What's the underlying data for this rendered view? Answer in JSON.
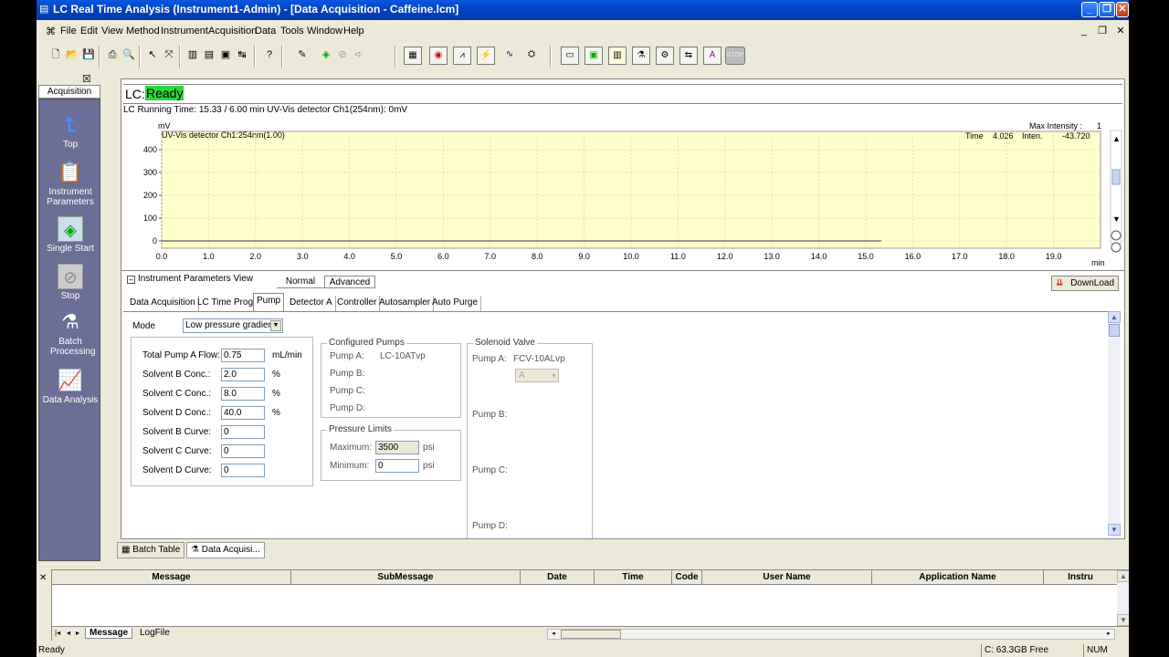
{
  "window": {
    "title": "LC Real Time Analysis (Instrument1-Admin) - [Data Acquisition - Caffeine.lcm]"
  },
  "menu": [
    "File",
    "Edit",
    "View",
    "Method",
    "Instrument",
    "Acquisition",
    "Data",
    "Tools",
    "Window",
    "Help"
  ],
  "sidebar": {
    "tab": "Acquisition",
    "items": [
      {
        "label": "Top",
        "icon": "up-arrow-icon"
      },
      {
        "label": "Instrument Parameters",
        "icon": "instrument-parameters-icon"
      },
      {
        "label": "Single Start",
        "icon": "single-start-icon"
      },
      {
        "label": "Stop",
        "icon": "stop-icon"
      },
      {
        "label": "Batch Processing",
        "icon": "batch-processing-icon"
      },
      {
        "label": "Data Analysis",
        "icon": "data-analysis-icon"
      }
    ]
  },
  "lc_status": {
    "label": "LC:",
    "value": "Ready",
    "color": "#2cd83b"
  },
  "running_text": "LC Running Time: 15.33 / 6.00 min UV-Vis detector Ch1(254nm): 0mV",
  "chart_data": {
    "type": "line",
    "ylabel": "mV",
    "xlabel": "min",
    "series_label": "UV-Vis detector Ch1:254nm(1.00)",
    "y_ticks": [
      400,
      300,
      200,
      100,
      0
    ],
    "x_ticks": [
      "0.0",
      "1.0",
      "2.0",
      "3.0",
      "4.0",
      "5.0",
      "6.0",
      "7.0",
      "8.0",
      "9.0",
      "10.0",
      "11.0",
      "12.0",
      "13.0",
      "14.0",
      "15.0",
      "16.0",
      "17.0",
      "18.0",
      "19.0"
    ],
    "ylim": [
      0,
      480
    ],
    "xlim": [
      0,
      20
    ],
    "series": [
      {
        "x": [
          0,
          15.33
        ],
        "y": [
          0,
          0
        ]
      }
    ],
    "readout": {
      "max_intensity_label": "Max Intensity :",
      "max_intensity_value": "1",
      "time_label": "Time",
      "time_value": "4.026",
      "inten_label": "Inten.",
      "inten_value": "-43.720"
    },
    "background": "#ffffcc"
  },
  "params_view": {
    "title": "Instrument Parameters View",
    "view_tabs": [
      "Normal",
      "Advanced"
    ],
    "download_label": "DownLoad",
    "tabs": [
      "Data Acquisition",
      "LC Time Prog.",
      "Pump",
      "Detector A",
      "Controller",
      "Autosampler",
      "Auto Purge"
    ],
    "active_tab": "Pump",
    "mode_label": "Mode",
    "mode_value": "Low pressure gradient",
    "fields": [
      {
        "label": "Total Pump A Flow:",
        "value": "0.75",
        "unit": "mL/min"
      },
      {
        "label": "Solvent B Conc.:",
        "value": "2.0",
        "unit": "%"
      },
      {
        "label": "Solvent C Conc.:",
        "value": "8.0",
        "unit": "%"
      },
      {
        "label": "Solvent D Conc.:",
        "value": "40.0",
        "unit": "%"
      },
      {
        "label": "Solvent B Curve:",
        "value": "0",
        "unit": ""
      },
      {
        "label": "Solvent C Curve:",
        "value": "0",
        "unit": ""
      },
      {
        "label": "Solvent D Curve:",
        "value": "0",
        "unit": ""
      }
    ],
    "configured_pumps": {
      "title": "Configured Pumps",
      "rows": [
        {
          "label": "Pump A:",
          "value": "LC-10ATvp"
        },
        {
          "label": "Pump B:",
          "value": ""
        },
        {
          "label": "Pump C:",
          "value": ""
        },
        {
          "label": "Pump D:",
          "value": ""
        }
      ]
    },
    "pressure_limits": {
      "title": "Pressure Limits",
      "max_label": "Maximum:",
      "max_value": "3500",
      "min_label": "Minimum:",
      "min_value": "0",
      "unit": "psi"
    },
    "solenoid": {
      "title": "Solenoid Valve",
      "pump_a_label": "Pump A:",
      "pump_a_value": "FCV-10ALvp",
      "select_value": "A",
      "pump_b_label": "Pump B:",
      "pump_c_label": "Pump C:",
      "pump_d_label": "Pump D:"
    }
  },
  "doc_tabs": [
    "Batch Table",
    "Data Acquisi..."
  ],
  "messages": {
    "columns": [
      "Message",
      "SubMessage",
      "Date",
      "Time",
      "Code",
      "User Name",
      "Application Name",
      "Instru"
    ],
    "tabs": [
      "Message",
      "LogFile"
    ]
  },
  "statusbar": {
    "text": "Ready",
    "disk": "C: 63.3GB Free",
    "num": "NUM"
  }
}
